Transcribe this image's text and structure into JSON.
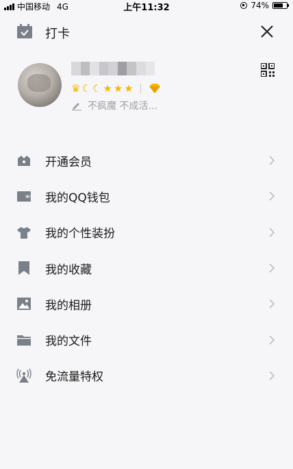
{
  "status_bar": {
    "carrier": "中国移动",
    "network": "4G",
    "time": "上午11:32",
    "battery": "74%",
    "battery_level": 0.74
  },
  "header": {
    "checkin_label": "打卡"
  },
  "profile": {
    "signature": "不疯魔 不成活..."
  },
  "menu": {
    "items": [
      {
        "label": "开通会员"
      },
      {
        "label": "我的QQ钱包"
      },
      {
        "label": "我的个性装扮"
      },
      {
        "label": "我的收藏"
      },
      {
        "label": "我的相册"
      },
      {
        "label": "我的文件"
      },
      {
        "label": "免流量特权"
      }
    ]
  },
  "colors": {
    "icon_gray": "#7a8089",
    "badge_gold": "#f5b800",
    "background": "#f6f6f8"
  }
}
